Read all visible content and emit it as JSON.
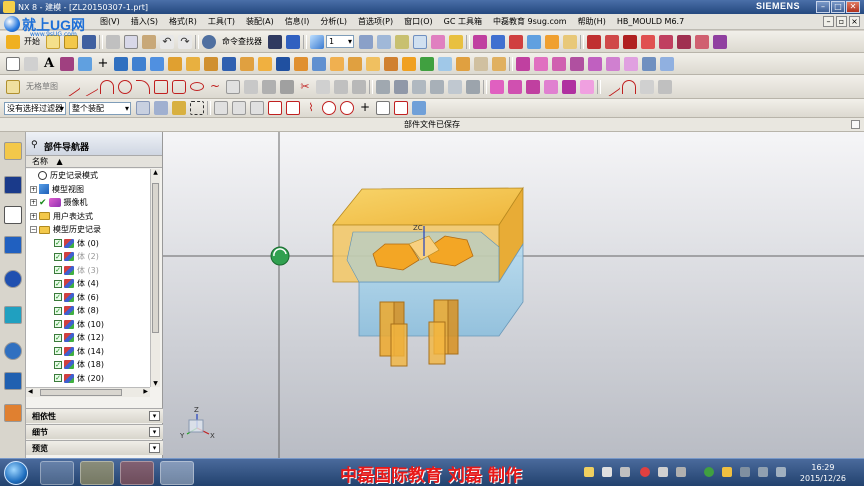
{
  "window": {
    "title": "NX 8 - 建模 - [ZL20150307-1.prt]",
    "brand": "SIEMENS"
  },
  "logo": {
    "text": "就上UG网",
    "url_text": "www.9sUG.com"
  },
  "menu": {
    "items": [
      "图(V)",
      "插入(S)",
      "格式(R)",
      "工具(T)",
      "装配(A)",
      "信息(I)",
      "分析(L)",
      "首选项(P)",
      "窗口(O)",
      "GC 工具箱",
      "中磊教育 9sug.com",
      "帮助(H)",
      "HB_MOULD M6.7"
    ]
  },
  "toolbar": {
    "open_label": "开始",
    "command_finder_label": "命令查找器",
    "layer_value": "1",
    "filter_value": "没有选择过滤器",
    "assembly_value": "整个装配",
    "draft_label": "无格草图"
  },
  "status": {
    "message": "部件文件已保存"
  },
  "navigator": {
    "title": "部件导航器",
    "column_name": "名称",
    "history_mode": "历史记录模式",
    "model_views": "模型视图",
    "cameras": "摄像机",
    "user_expressions": "用户表达式",
    "model_history": "模型历史记录",
    "body_label": "体",
    "bodies": [
      {
        "id": "(0)",
        "dim": false
      },
      {
        "id": "(2)",
        "dim": true
      },
      {
        "id": "(3)",
        "dim": true
      },
      {
        "id": "(4)",
        "dim": false
      },
      {
        "id": "(6)",
        "dim": false
      },
      {
        "id": "(8)",
        "dim": false
      },
      {
        "id": "(10)",
        "dim": false
      },
      {
        "id": "(12)",
        "dim": false
      },
      {
        "id": "(14)",
        "dim": false
      },
      {
        "id": "(18)",
        "dim": false
      },
      {
        "id": "(20)",
        "dim": false
      }
    ],
    "panels": {
      "dependencies": "相依性",
      "details": "细节",
      "preview": "预览"
    }
  },
  "viewport": {
    "axis_zc": "ZC",
    "triad_z": "Z",
    "triad_x": "X",
    "triad_y": "Y"
  },
  "taskbar": {
    "caption": "中磊国际教育  刘磊  制作",
    "time": "16:29",
    "date": "2015/12/26"
  },
  "colors": {
    "mold_yellow": "#f2b93a",
    "mold_blue": "#9ec9e6",
    "part_orange": "#f0a020"
  }
}
